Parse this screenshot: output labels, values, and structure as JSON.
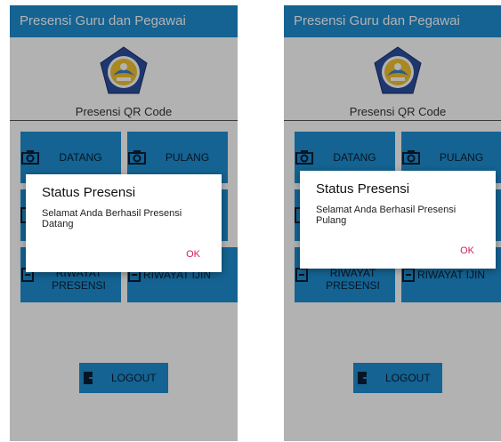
{
  "screens": [
    {
      "app_title": "Presensi Guru dan Pegawai",
      "subtitle": "Presensi QR Code",
      "buttons": {
        "datang": "DATANG",
        "pulang": "PULANG",
        "riwayat_presensi": "RIWAYAT\nPRESENSI",
        "riwayat_ijin": "RIWAYAT IJIN",
        "logout": "LOGOUT"
      },
      "dialog": {
        "title": "Status Presensi",
        "message": "Selamat Anda Berhasil Presensi Datang",
        "ok_label": "OK"
      }
    },
    {
      "app_title": "Presensi Guru dan Pegawai",
      "subtitle": "Presensi QR Code",
      "buttons": {
        "datang": "DATANG",
        "pulang": "PULANG",
        "riwayat_presensi": "RIWAYAT\nPRESENSI",
        "riwayat_ijin": "RIWAYAT IJIN",
        "logout": "LOGOUT"
      },
      "dialog": {
        "title": "Status Presensi",
        "message": "Selamat Anda Berhasil Presensi Pulang",
        "ok_label": "OK"
      }
    }
  ],
  "colors": {
    "app_bar": "#1e8ed1",
    "button": "#1e8ed1",
    "dialog_ok": "#d81b60"
  },
  "icons": {
    "datang": "camera-icon",
    "pulang": "camera-icon",
    "riwayat_presensi": "document-icon",
    "riwayat_ijin": "document-icon",
    "logout": "exit-icon",
    "logo": "tut-wuri-handayani-emblem"
  }
}
